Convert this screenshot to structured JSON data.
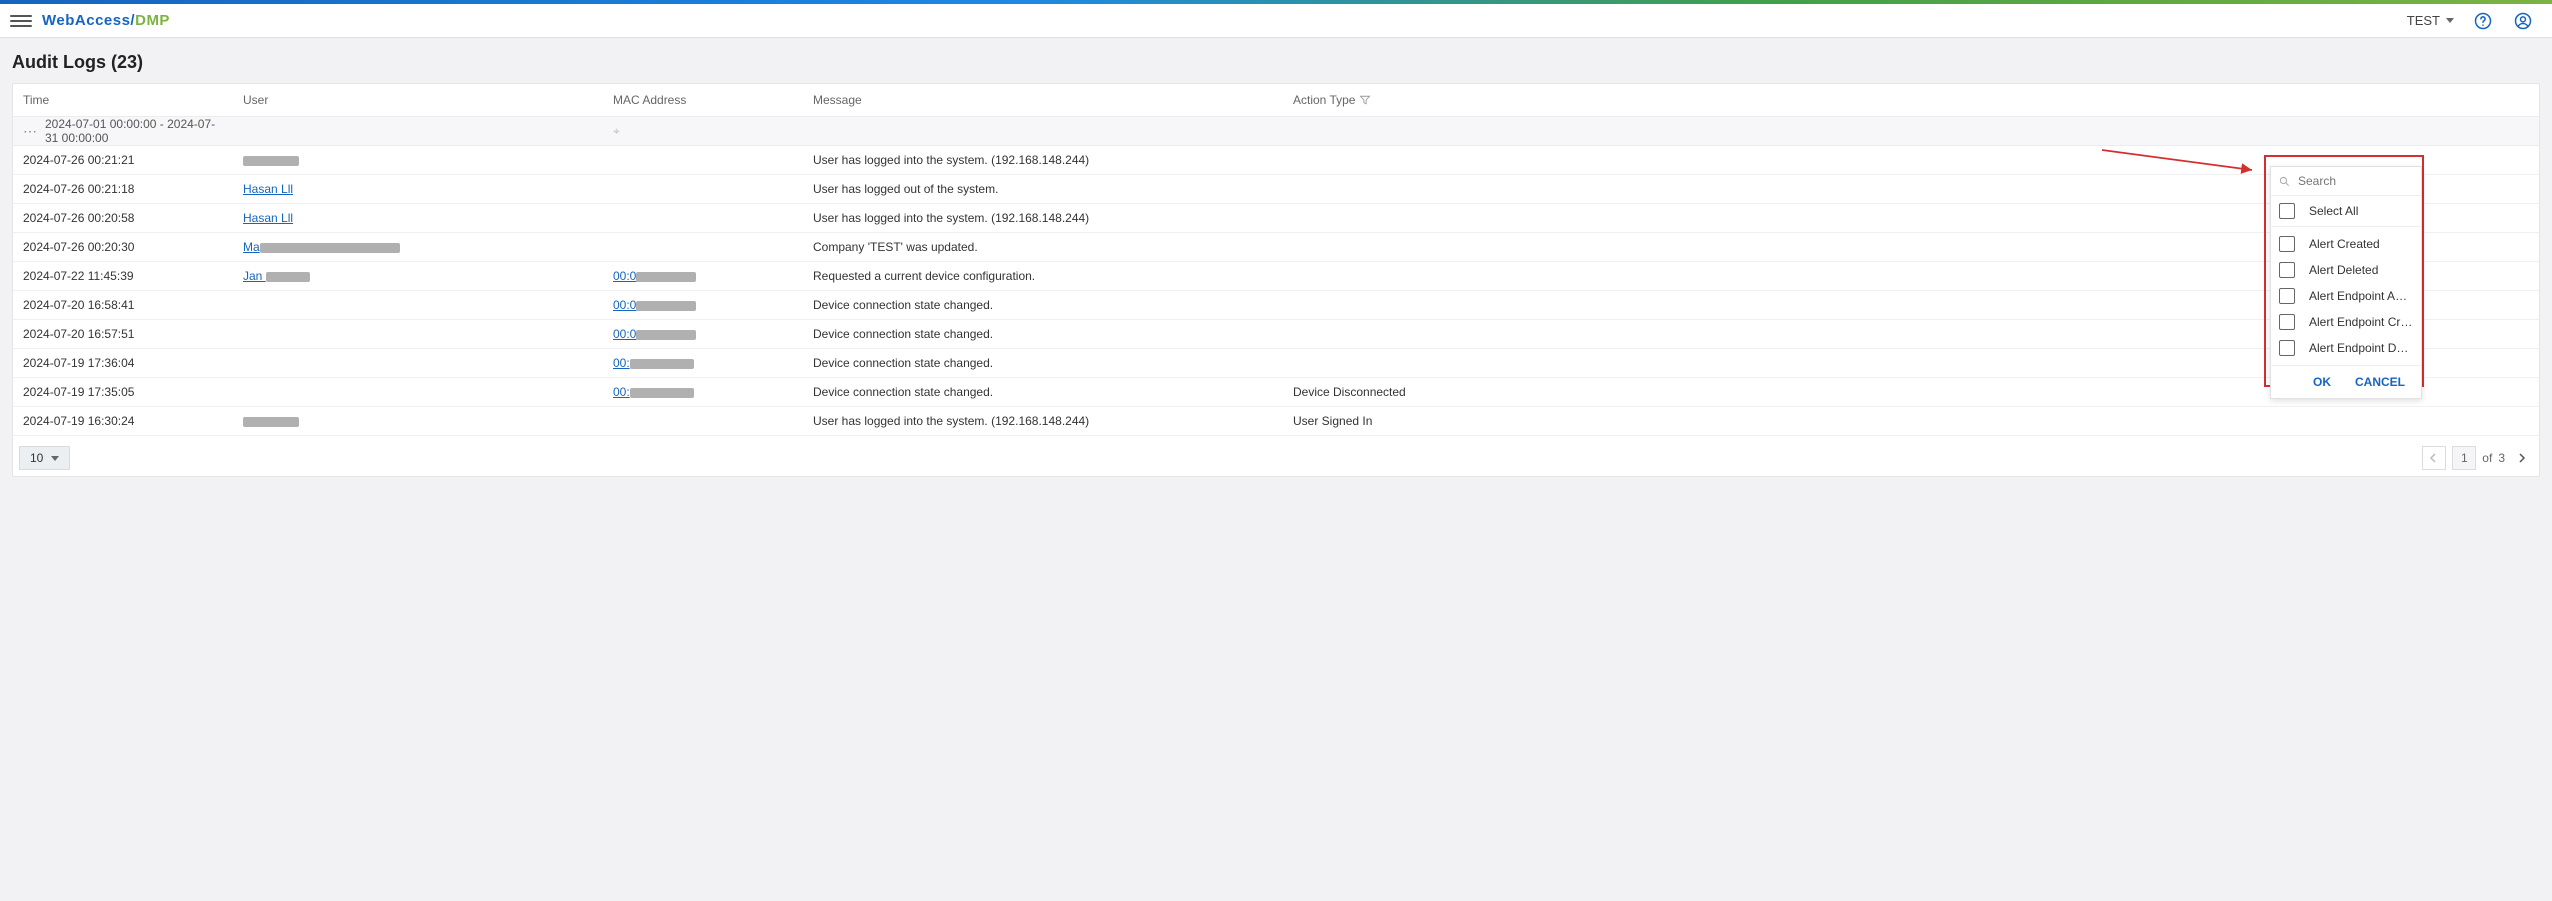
{
  "header": {
    "logo_a": "WebAccess/",
    "logo_b": "DMP",
    "user_label": "TEST"
  },
  "page": {
    "title": "Audit Logs (23)"
  },
  "columns": {
    "time": "Time",
    "user": "User",
    "mac": "MAC Address",
    "message": "Message",
    "action_type": "Action Type"
  },
  "filter_row": {
    "time_range": "2024-07-01 00:00:00 - 2024-07-31 00:00:00"
  },
  "rows": [
    {
      "time": "2024-07-26 00:21:21",
      "user_redact_w": 56,
      "mac": "",
      "mac_redact_w": 0,
      "message": "User has logged into the system. (192.168.148.244)",
      "action": ""
    },
    {
      "time": "2024-07-26 00:21:18",
      "user_text": "Hasan Lll",
      "mac": "",
      "message": "User has logged out of the system.",
      "action": ""
    },
    {
      "time": "2024-07-26 00:20:58",
      "user_text": "Hasan Lll",
      "mac": "",
      "message": "User has logged into the system. (192.168.148.244)",
      "action": ""
    },
    {
      "time": "2024-07-26 00:20:30",
      "user_prefix": "Ma",
      "user_redact_w": 140,
      "mac": "",
      "message": "Company 'TEST' was updated.",
      "action": ""
    },
    {
      "time": "2024-07-22 11:45:39",
      "user_prefix": "Jan ",
      "user_redact_w": 44,
      "mac_prefix": "00:0",
      "mac_redact_w": 60,
      "message": "Requested a current device configuration.",
      "action": ""
    },
    {
      "time": "2024-07-20 16:58:41",
      "mac_prefix": "00:0",
      "mac_redact_w": 60,
      "message": "Device connection state changed.",
      "action": ""
    },
    {
      "time": "2024-07-20 16:57:51",
      "mac_prefix": "00:0",
      "mac_redact_w": 60,
      "message": "Device connection state changed.",
      "action": ""
    },
    {
      "time": "2024-07-19 17:36:04",
      "mac_prefix": "00:",
      "mac_redact_w": 64,
      "message": "Device connection state changed.",
      "action": ""
    },
    {
      "time": "2024-07-19 17:35:05",
      "mac_prefix": "00:",
      "mac_redact_w": 64,
      "message": "Device connection state changed.",
      "action": "Device Disconnected"
    },
    {
      "time": "2024-07-19 16:30:24",
      "user_redact_w": 56,
      "mac": "",
      "message": "User has logged into the system. (192.168.148.244)",
      "action": "User Signed In"
    }
  ],
  "popup": {
    "search_ph": "Search",
    "select_all": "Select All",
    "options": [
      "Alert Created",
      "Alert Deleted",
      "Alert Endpoint Assignmen…",
      "Alert Endpoint Created",
      "Alert Endpoint Deleted"
    ],
    "ok": "OK",
    "cancel": "CANCEL"
  },
  "pagination": {
    "page_size": "10",
    "current": "1",
    "of_label": "of",
    "total": "3"
  }
}
